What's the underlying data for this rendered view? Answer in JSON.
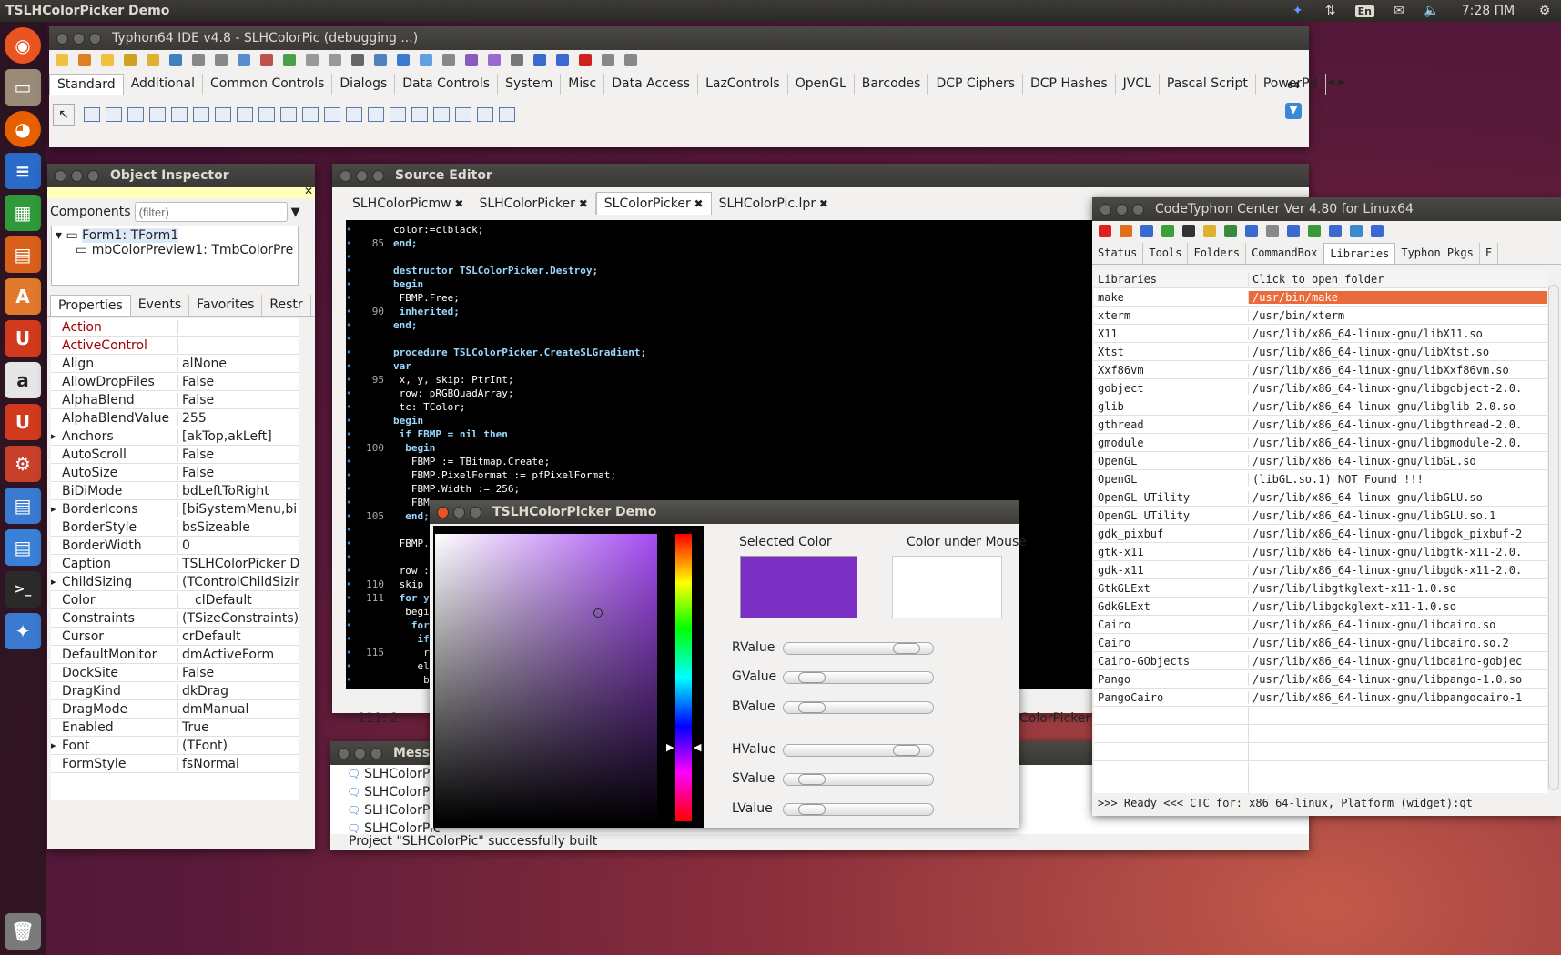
{
  "topbar": {
    "app_title": "TSLHColorPicker Demo",
    "lang": "En",
    "time": "7:28 ПМ"
  },
  "ide": {
    "title": "Typhon64 IDE v4.8 - SLHColorPic (debugging ...)",
    "palette_tabs": [
      "Standard",
      "Additional",
      "Common Controls",
      "Dialogs",
      "Data Controls",
      "System",
      "Misc",
      "Data Access",
      "LazControls",
      "OpenGL",
      "Barcodes",
      "DCP Ciphers",
      "DCP Hashes",
      "JVCL",
      "Pascal Script",
      "PowerPd"
    ],
    "bits": "64"
  },
  "inspector": {
    "title": "Object Inspector",
    "components_label": "Components",
    "filter_placeholder": "(filter)",
    "tree": [
      "Form1: TForm1",
      "mbColorPreview1: TmbColorPrev"
    ],
    "tabs": [
      "Properties",
      "Events",
      "Favorites",
      "Restr"
    ],
    "props": [
      {
        "name": "Action",
        "value": ""
      },
      {
        "name": "ActiveControl",
        "value": ""
      },
      {
        "name": "Align",
        "value": "alNone"
      },
      {
        "name": "AllowDropFiles",
        "value": "False"
      },
      {
        "name": "AlphaBlend",
        "value": "False"
      },
      {
        "name": "AlphaBlendValue",
        "value": "255"
      },
      {
        "name": "Anchors",
        "value": "[akTop,akLeft]"
      },
      {
        "name": "AutoScroll",
        "value": "False"
      },
      {
        "name": "AutoSize",
        "value": "False"
      },
      {
        "name": "BiDiMode",
        "value": "bdLeftToRight"
      },
      {
        "name": "BorderIcons",
        "value": "[biSystemMenu,bi"
      },
      {
        "name": "BorderStyle",
        "value": "bsSizeable"
      },
      {
        "name": "BorderWidth",
        "value": "0"
      },
      {
        "name": "Caption",
        "value": "TSLHColorPicker D"
      },
      {
        "name": "ChildSizing",
        "value": "(TControlChildSizin"
      },
      {
        "name": "Color",
        "value": "clDefault"
      },
      {
        "name": "Constraints",
        "value": "(TSizeConstraints)"
      },
      {
        "name": "Cursor",
        "value": "crDefault"
      },
      {
        "name": "DefaultMonitor",
        "value": "dmActiveForm"
      },
      {
        "name": "DockSite",
        "value": "False"
      },
      {
        "name": "DragKind",
        "value": "dkDrag"
      },
      {
        "name": "DragMode",
        "value": "dmManual"
      },
      {
        "name": "Enabled",
        "value": "True"
      },
      {
        "name": "Font",
        "value": "(TFont)"
      },
      {
        "name": "FormStyle",
        "value": "fsNormal"
      }
    ]
  },
  "editor": {
    "title": "Source Editor",
    "tabs": [
      "SLHColorPicmw",
      "SLHColorPicker",
      "SLColorPicker",
      "SLHColorPic.lpr"
    ],
    "lines": [
      {
        "n": "",
        "t": "color:=clblack;"
      },
      {
        "n": "85",
        "t": "end;"
      },
      {
        "n": "",
        "t": ""
      },
      {
        "n": "",
        "t": "destructor TSLColorPicker.Destroy;"
      },
      {
        "n": "",
        "t": "begin"
      },
      {
        "n": "",
        "t": " FBMP.Free;"
      },
      {
        "n": "90",
        "t": " inherited;"
      },
      {
        "n": "",
        "t": "end;"
      },
      {
        "n": "",
        "t": ""
      },
      {
        "n": "",
        "t": "procedure TSLColorPicker.CreateSLGradient;"
      },
      {
        "n": "",
        "t": "var"
      },
      {
        "n": "95",
        "t": " x, y, skip: PtrInt;"
      },
      {
        "n": "",
        "t": " row: pRGBQuadArray;"
      },
      {
        "n": "",
        "t": " tc: TColor;"
      },
      {
        "n": "",
        "t": "begin"
      },
      {
        "n": "",
        "t": " if FBMP = nil then"
      },
      {
        "n": "100",
        "t": "  begin"
      },
      {
        "n": "",
        "t": "   FBMP := TBitmap.Create;"
      },
      {
        "n": "",
        "t": "   FBMP.PixelFormat := pfPixelFormat;"
      },
      {
        "n": "",
        "t": "   FBMP.Width := 256;"
      },
      {
        "n": "",
        "t": "   FBM"
      },
      {
        "n": "105",
        "t": "  end;"
      },
      {
        "n": "",
        "t": ""
      },
      {
        "n": "",
        "t": " FBMP."
      },
      {
        "n": "",
        "t": ""
      },
      {
        "n": "",
        "t": " row :"
      },
      {
        "n": "110",
        "t": " skip"
      },
      {
        "n": "111",
        "t": " for y"
      },
      {
        "n": "",
        "t": "  begi"
      },
      {
        "n": "",
        "t": "   for"
      },
      {
        "n": "",
        "t": "    if"
      },
      {
        "n": "115",
        "t": "     r"
      },
      {
        "n": "",
        "t": "    el"
      },
      {
        "n": "",
        "t": "     b"
      }
    ],
    "status": "111:  2",
    "tail_tab": "ColorPicker"
  },
  "messages": {
    "title": "Messa",
    "items": [
      "SLHColorPic",
      "SLHColorPic",
      "SLHColorPic",
      "SLHColorPic"
    ],
    "built": "Project \"SLHColorPic\" successfully built"
  },
  "ctc": {
    "title": "CodeTyphon Center Ver 4.80 for Linux64",
    "tabs": [
      "Status",
      "Tools",
      "Folders",
      "CommandBox",
      "Libraries",
      "Typhon Pkgs",
      "F"
    ],
    "col1": "Libraries",
    "col2": "Click to open folder",
    "rows": [
      {
        "k": "make",
        "v": "/usr/bin/make"
      },
      {
        "k": "xterm",
        "v": "/usr/bin/xterm"
      },
      {
        "k": "X11",
        "v": "/usr/lib/x86_64-linux-gnu/libX11.so"
      },
      {
        "k": "Xtst",
        "v": "/usr/lib/x86_64-linux-gnu/libXtst.so"
      },
      {
        "k": "Xxf86vm",
        "v": "/usr/lib/x86_64-linux-gnu/libXxf86vm.so"
      },
      {
        "k": "gobject",
        "v": "/usr/lib/x86_64-linux-gnu/libgobject-2.0."
      },
      {
        "k": "glib",
        "v": "/usr/lib/x86_64-linux-gnu/libglib-2.0.so"
      },
      {
        "k": "gthread",
        "v": "/usr/lib/x86_64-linux-gnu/libgthread-2.0."
      },
      {
        "k": "gmodule",
        "v": "/usr/lib/x86_64-linux-gnu/libgmodule-2.0."
      },
      {
        "k": "OpenGL",
        "v": "/usr/lib/x86_64-linux-gnu/libGL.so"
      },
      {
        "k": "OpenGL",
        "v": "(libGL.so.1) NOT Found !!!"
      },
      {
        "k": "OpenGL UTility",
        "v": "/usr/lib/x86_64-linux-gnu/libGLU.so"
      },
      {
        "k": "OpenGL UTility",
        "v": "/usr/lib/x86_64-linux-gnu/libGLU.so.1"
      },
      {
        "k": "gdk_pixbuf",
        "v": "/usr/lib/x86_64-linux-gnu/libgdk_pixbuf-2"
      },
      {
        "k": "gtk-x11",
        "v": "/usr/lib/x86_64-linux-gnu/libgtk-x11-2.0."
      },
      {
        "k": "gdk-x11",
        "v": "/usr/lib/x86_64-linux-gnu/libgdk-x11-2.0."
      },
      {
        "k": "GtkGLExt",
        "v": "/usr/lib/libgtkglext-x11-1.0.so"
      },
      {
        "k": "GdkGLExt",
        "v": "/usr/lib/libgdkglext-x11-1.0.so"
      },
      {
        "k": "Cairo",
        "v": "/usr/lib/x86_64-linux-gnu/libcairo.so"
      },
      {
        "k": "Cairo",
        "v": "/usr/lib/x86_64-linux-gnu/libcairo.so.2"
      },
      {
        "k": "Cairo-GObjects",
        "v": "/usr/lib/x86_64-linux-gnu/libcairo-gobjec"
      },
      {
        "k": "Pango",
        "v": "/usr/lib/x86_64-linux-gnu/libpango-1.0.so"
      },
      {
        "k": "PangoCairo",
        "v": "/usr/lib/x86_64-linux-gnu/libpangocairo-1"
      }
    ],
    "status": ">>> Ready <<<   CTC for: x86_64-linux, Platform (widget):qt"
  },
  "demo": {
    "title": "TSLHColorPicker Demo",
    "selected_label": "Selected Color",
    "mouse_label": "Color under Mouse",
    "selected_color": "#7b2fc4",
    "mouse_color": "#ffffff",
    "sliders": [
      {
        "label": "RValue",
        "level": 0.93
      },
      {
        "label": "GValue",
        "level": 0.07
      },
      {
        "label": "BValue",
        "level": 0.07
      },
      {
        "label": "HValue",
        "level": 0.93
      },
      {
        "label": "SValue",
        "level": 0.07
      },
      {
        "label": "LValue",
        "level": 0.07
      }
    ]
  }
}
